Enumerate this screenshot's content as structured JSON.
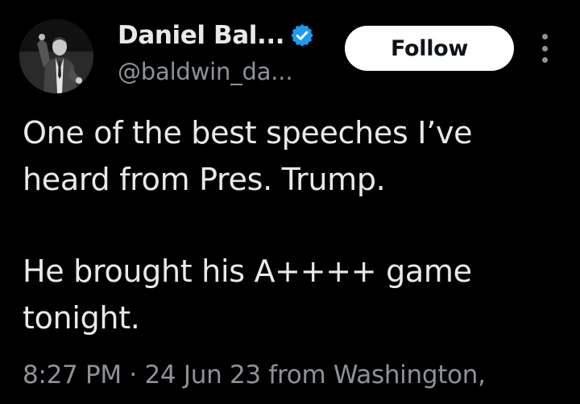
{
  "author": {
    "display_name": "Daniel Bal...",
    "handle": "@baldwin_da...",
    "verified": true,
    "verified_color": "#1d9bf0",
    "avatar_icon": "profile-photo"
  },
  "actions": {
    "follow_label": "Follow",
    "more_icon": "vertical-ellipsis-icon"
  },
  "tweet": {
    "paragraph1_line1": "One of the best speeches I’ve",
    "paragraph1_line2": "heard from Pres. Trump.",
    "paragraph2_line1": "He brought his A++++ game",
    "paragraph2_line2": "tonight."
  },
  "meta": {
    "time": "8:27 PM",
    "separator": "·",
    "date": "24 Jun 23",
    "source": "from Washington,"
  },
  "colors": {
    "background": "#000000",
    "text": "#e7e9ea",
    "secondary_text": "#8e9298",
    "follow_bg": "#ffffff",
    "follow_text": "#0f1419"
  }
}
